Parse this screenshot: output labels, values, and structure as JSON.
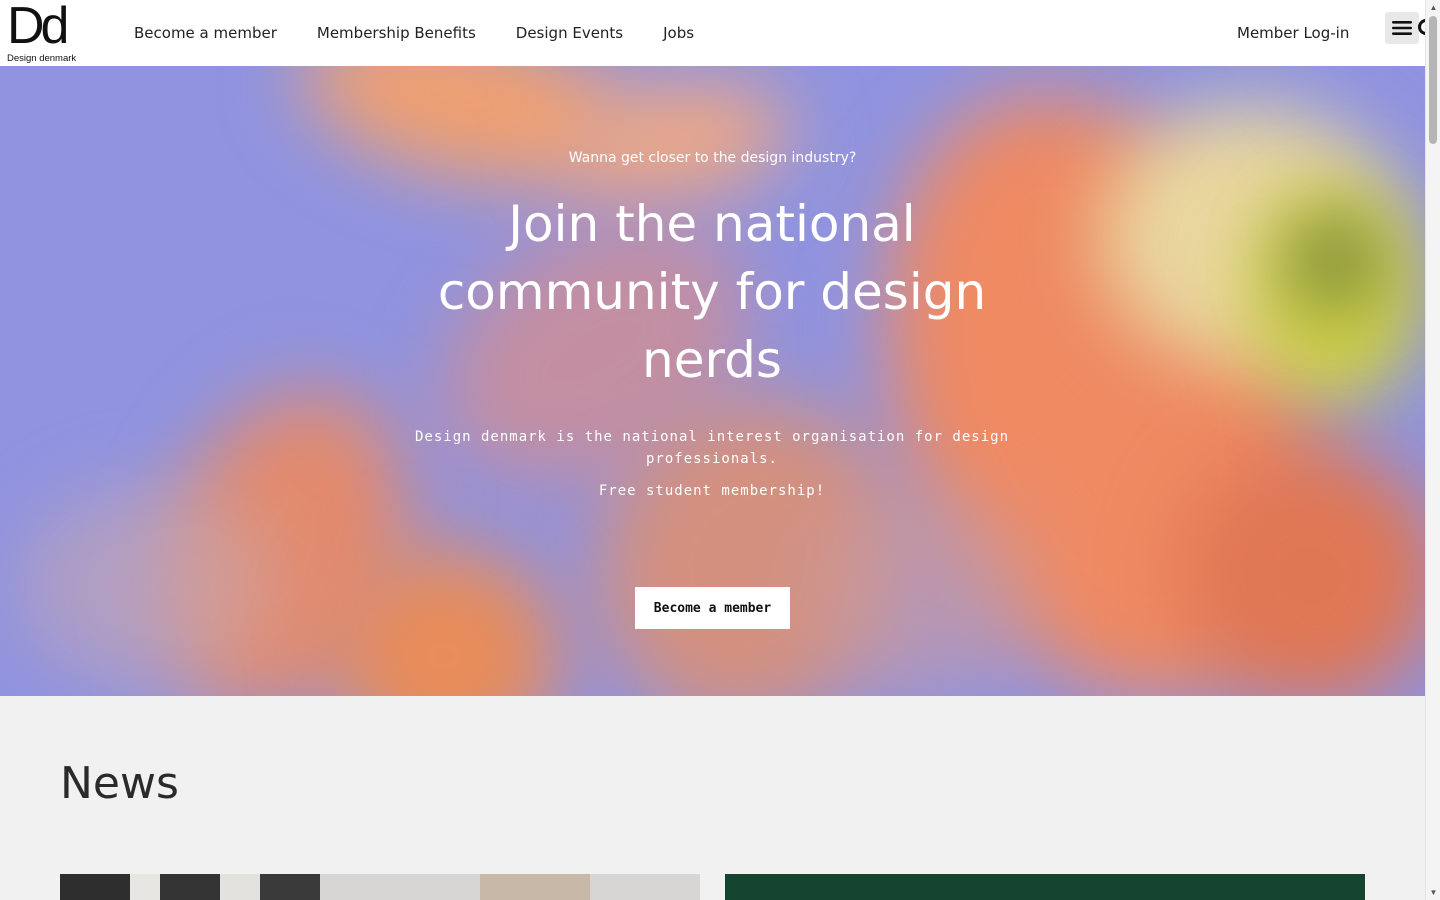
{
  "header": {
    "logo_mark": "Dd",
    "logo_sub": "Design denmark",
    "nav": [
      {
        "label": "Become a member"
      },
      {
        "label": "Membership Benefits"
      },
      {
        "label": "Design Events"
      },
      {
        "label": "Jobs"
      }
    ],
    "login_label": "Member Log-in",
    "menu_icon": "hamburger-menu-icon",
    "search_icon": "search-icon"
  },
  "hero": {
    "kicker": "Wanna get closer to the design industry?",
    "title": "Join the national community for design nerds",
    "description": "Design denmark is the national interest organisation for design professionals.",
    "free_note": "Free student membership!",
    "cta_label": "Become a member"
  },
  "news": {
    "title": "News"
  },
  "colors": {
    "hero_base": "#8f93e0",
    "cta_bg": "#ffffff",
    "page_bg": "#f1f1f1",
    "card_green": "#14432f"
  }
}
